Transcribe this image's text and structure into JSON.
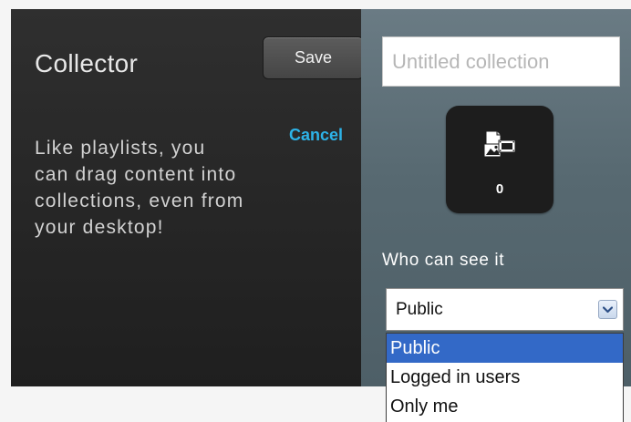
{
  "panel": {
    "title": "Collector",
    "description": "Like playlists, you can drag content into collections, even from your desktop!",
    "save_label": "Save",
    "cancel_label": "Cancel"
  },
  "collection": {
    "name_placeholder": "Untitled collection",
    "name_value": "",
    "item_count": "0",
    "media_icon": "media-collection-icon"
  },
  "visibility": {
    "label": "Who can see it",
    "selected": "Public",
    "options": [
      "Public",
      "Logged in users",
      "Only me"
    ],
    "highlighted_index": 0
  },
  "colors": {
    "left_panel": "#262626",
    "right_panel": "#576971",
    "cancel_link": "#2db3e8",
    "option_highlight": "#3369c7"
  }
}
